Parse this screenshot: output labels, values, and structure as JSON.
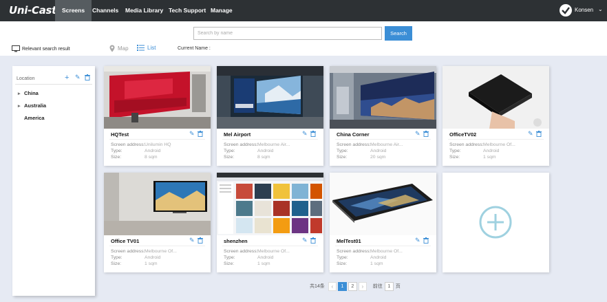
{
  "app": {
    "name": "Uni-Cast"
  },
  "nav": {
    "tabs": [
      {
        "label": "Screens"
      },
      {
        "label": "Channels"
      },
      {
        "label": "Media Library"
      },
      {
        "label": "Tech Support"
      },
      {
        "label": "Manage"
      }
    ],
    "active_tab": "Screens",
    "user": "Konsen"
  },
  "search": {
    "placeholder": "Search by name",
    "button_label": "Search",
    "relevant_label": "Relevant search result",
    "map_label": "Map",
    "list_label": "List",
    "current_name_label": "Current Name :"
  },
  "sidebar": {
    "header": "Location",
    "items": [
      {
        "label": "China",
        "expandable": true
      },
      {
        "label": "Australia",
        "expandable": true
      },
      {
        "label": "America",
        "expandable": false
      }
    ]
  },
  "field_labels": {
    "address": "Screen address:",
    "type": "Type:",
    "size": "Size:"
  },
  "screens": [
    {
      "name": "HQTest",
      "address": "Unilumin HQ",
      "type": "Android",
      "size": "8 sqm",
      "thumbnail": "red-led-wall-lobby"
    },
    {
      "name": "Mel Airport",
      "address": "Melbourne Air...",
      "type": "Android",
      "size": "8 sqm",
      "thumbnail": "airport-display-wall"
    },
    {
      "name": "China Corner",
      "address": "Melbourne Air...",
      "type": "Android",
      "size": "20 sqm",
      "thumbnail": "cityscape-video-wall"
    },
    {
      "name": "OfficeTV02",
      "address": "Melbourne Of...",
      "type": "Android",
      "size": "1 sqm",
      "thumbnail": "android-tv-box"
    },
    {
      "name": "Office TV01",
      "address": "Melbourne Of...",
      "type": "Android",
      "size": "1 sqm",
      "thumbnail": "office-wall-tv"
    },
    {
      "name": "shenzhen",
      "address": "Melbourne Of...",
      "type": "Android",
      "size": "1 sqm",
      "thumbnail": "web-app-screenshot"
    },
    {
      "name": "MelTest01",
      "address": "Melbourne Of...",
      "type": "Android",
      "size": "1 sqm",
      "thumbnail": "android-tablet"
    }
  ],
  "add_card": {
    "icon": "plus-circle-icon"
  },
  "pagination": {
    "total_label": "共14条",
    "pages": [
      "1",
      "2"
    ],
    "current_page": "1",
    "goto_label": "前往",
    "goto_value": "1",
    "page_unit": "页"
  },
  "colors": {
    "accent": "#3b8ed6",
    "nav_bg": "#2d3134",
    "nav_active": "#565c60",
    "body_bg": "#e6eaf3",
    "add_icon": "#9fd1e0"
  }
}
